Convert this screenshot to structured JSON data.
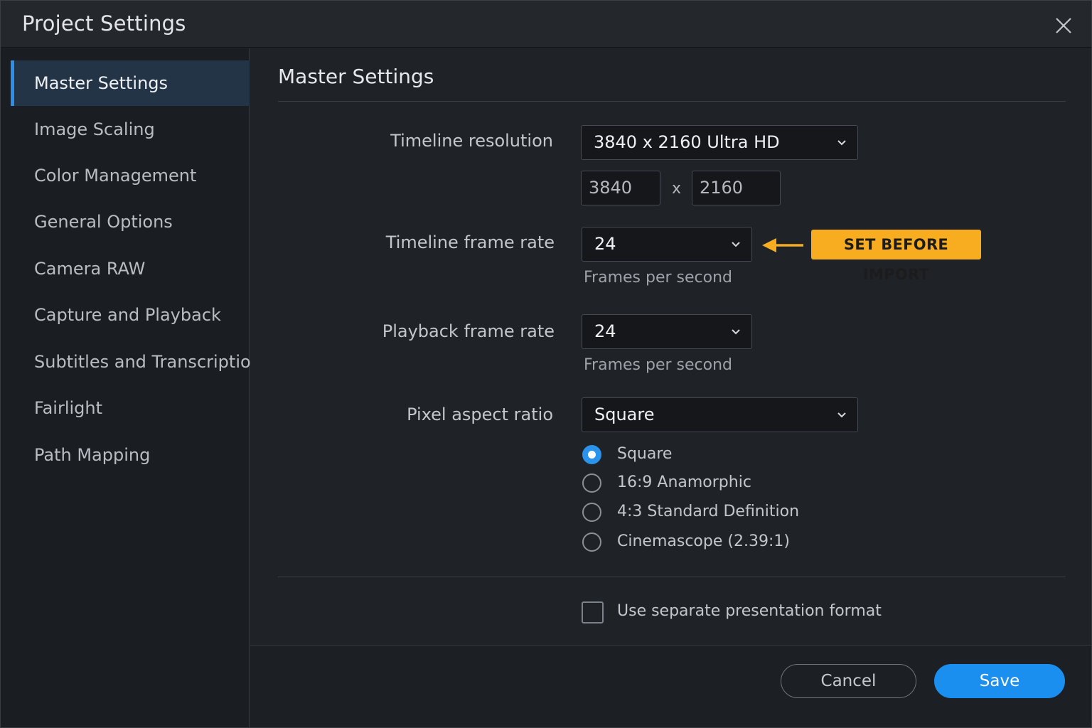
{
  "window": {
    "title": "Project Settings"
  },
  "sidebar": {
    "items": [
      {
        "label": "Master Settings",
        "active": true
      },
      {
        "label": "Image Scaling"
      },
      {
        "label": "Color Management"
      },
      {
        "label": "General Options"
      },
      {
        "label": "Camera RAW"
      },
      {
        "label": "Capture and Playback"
      },
      {
        "label": "Subtitles and Transcription"
      },
      {
        "label": "Fairlight"
      },
      {
        "label": "Path Mapping"
      }
    ]
  },
  "main": {
    "title": "Master Settings",
    "timeline_resolution": {
      "label": "Timeline resolution",
      "value": "3840 x 2160 Ultra HD",
      "width": "3840",
      "separator": "x",
      "height": "2160"
    },
    "timeline_frame_rate": {
      "label": "Timeline frame rate",
      "value": "24",
      "hint": "Frames per second",
      "callout": "SET BEFORE IMPORT"
    },
    "playback_frame_rate": {
      "label": "Playback frame rate",
      "value": "24",
      "hint": "Frames per second"
    },
    "pixel_aspect_ratio": {
      "label": "Pixel aspect ratio",
      "value": "Square",
      "options": [
        {
          "label": "Square",
          "selected": true
        },
        {
          "label": "16:9 Anamorphic",
          "selected": false
        },
        {
          "label": "4:3 Standard Definition",
          "selected": false
        },
        {
          "label": "Cinemascope (2.39:1)",
          "selected": false
        }
      ]
    },
    "presentation_format": {
      "label": "Use separate presentation format",
      "checked": false
    }
  },
  "footer": {
    "cancel_label": "Cancel",
    "save_label": "Save"
  },
  "colors": {
    "accent": "#1b8ff0",
    "callout": "#f7ad1f",
    "background": "#1f2227"
  },
  "icons": {
    "close": "close-icon",
    "dropdown": "chevron-down-icon",
    "arrow": "arrow-left-icon"
  }
}
